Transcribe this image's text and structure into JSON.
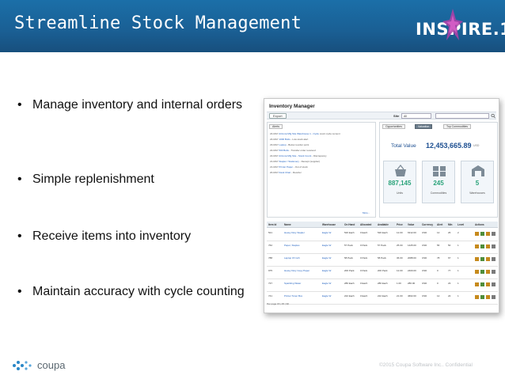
{
  "header": {
    "title": "Streamline Stock Management",
    "logo_text": "INSPIRE.15"
  },
  "bullets": [
    "Manage inventory and internal orders",
    "Simple replenishment",
    "Receive items into inventory",
    "Maintain accuracy with cycle counting"
  ],
  "screenshot": {
    "title": "Inventory Manager",
    "export_label": "Export",
    "site_label": "Site",
    "site_value": "All",
    "log_tab": "Alerts",
    "log_lines": [
      {
        "date": "24-MAY",
        "link": "Arizona Mfg Site Warehouse 1 - Cycle",
        "rest": "count cycle recount"
      },
      {
        "date": "24-MAY",
        "link": "1000 Bolts",
        "rest": "- Low stock alert"
      },
      {
        "date": "23-MAY",
        "link": "Laptop",
        "rest": "- Below reorder point"
      },
      {
        "date": "22-MAY",
        "link": "500 Bolts",
        "rest": "- Transfer order received"
      },
      {
        "date": "22-MAY",
        "link": "Arizona Mfg Site - Stock Count",
        "rest": "- Discrepancy"
      },
      {
        "date": "21-MAY",
        "link": "Stapler / Stationery",
        "rest": "- Receipt (supplier)"
      },
      {
        "date": "21-MAY",
        "link": "Printer Paper",
        "rest": "- Out of stock"
      },
      {
        "date": "20-MAY",
        "link": "Desk Chair",
        "rest": "- Reorder"
      }
    ],
    "log_more": "More...",
    "tabs": [
      "Opportunities",
      "Valuation",
      "Top Commodities"
    ],
    "total_label": "Total Value",
    "total_value": "12,453,665.89",
    "total_currency": "USD",
    "stats": [
      {
        "value": "887,145",
        "label": "Units"
      },
      {
        "value": "245",
        "label": "Commodities"
      },
      {
        "value": "5",
        "label": "Warehouses"
      }
    ],
    "grid_headers": [
      "Item Id",
      "Name",
      "Warehouse",
      "On Hand",
      "Allocated",
      "Available",
      "Price",
      "Value",
      "Currency",
      "Alert",
      "Min",
      "Level",
      "Actions"
    ],
    "grid_rows": [
      [
        "521",
        "Heavy Duty Stapler",
        "Eagle W",
        "526 Each",
        "0 Each",
        "526 Each",
        "12.00",
        "6312.00",
        "USD",
        "12",
        "26",
        "2"
      ],
      [
        "762",
        "Paper, Staples",
        "Eagle W",
        "57 Pack",
        "0 Pack",
        "57 Pack",
        "25.00",
        "1425.00",
        "USD",
        "56",
        "50",
        "1"
      ],
      [
        "788",
        "Laptop 15 Inch",
        "Eagle W",
        "58 Pack",
        "0 Pack",
        "58 Pack",
        "36.00",
        "2088.00",
        "USD",
        "78",
        "67",
        "1"
      ],
      [
        "975",
        "Heavy Duty Copy Paper",
        "Eagle W",
        "200 Pack",
        "0 Pack",
        "200 Pack",
        "12.00",
        "2400.00",
        "USD",
        "0",
        "77",
        "1"
      ],
      [
        "737",
        "Sparkling Water",
        "Eagle W",
        "286 Each",
        "0 Each",
        "286 Each",
        "1.00",
        "286.00",
        "USD",
        "0",
        "23",
        "1"
      ],
      [
        "741",
        "Printer Toner Box",
        "Eagle W",
        "222 Each",
        "0 Each",
        "222 Each",
        "21.00",
        "4662.00",
        "USD",
        "12",
        "24",
        "1"
      ]
    ],
    "pager": "Per page  15 | 45 | 90"
  },
  "footer": {
    "brand": "coupa",
    "copyright": "©2015 Coupa Software Inc.. Confidential"
  }
}
